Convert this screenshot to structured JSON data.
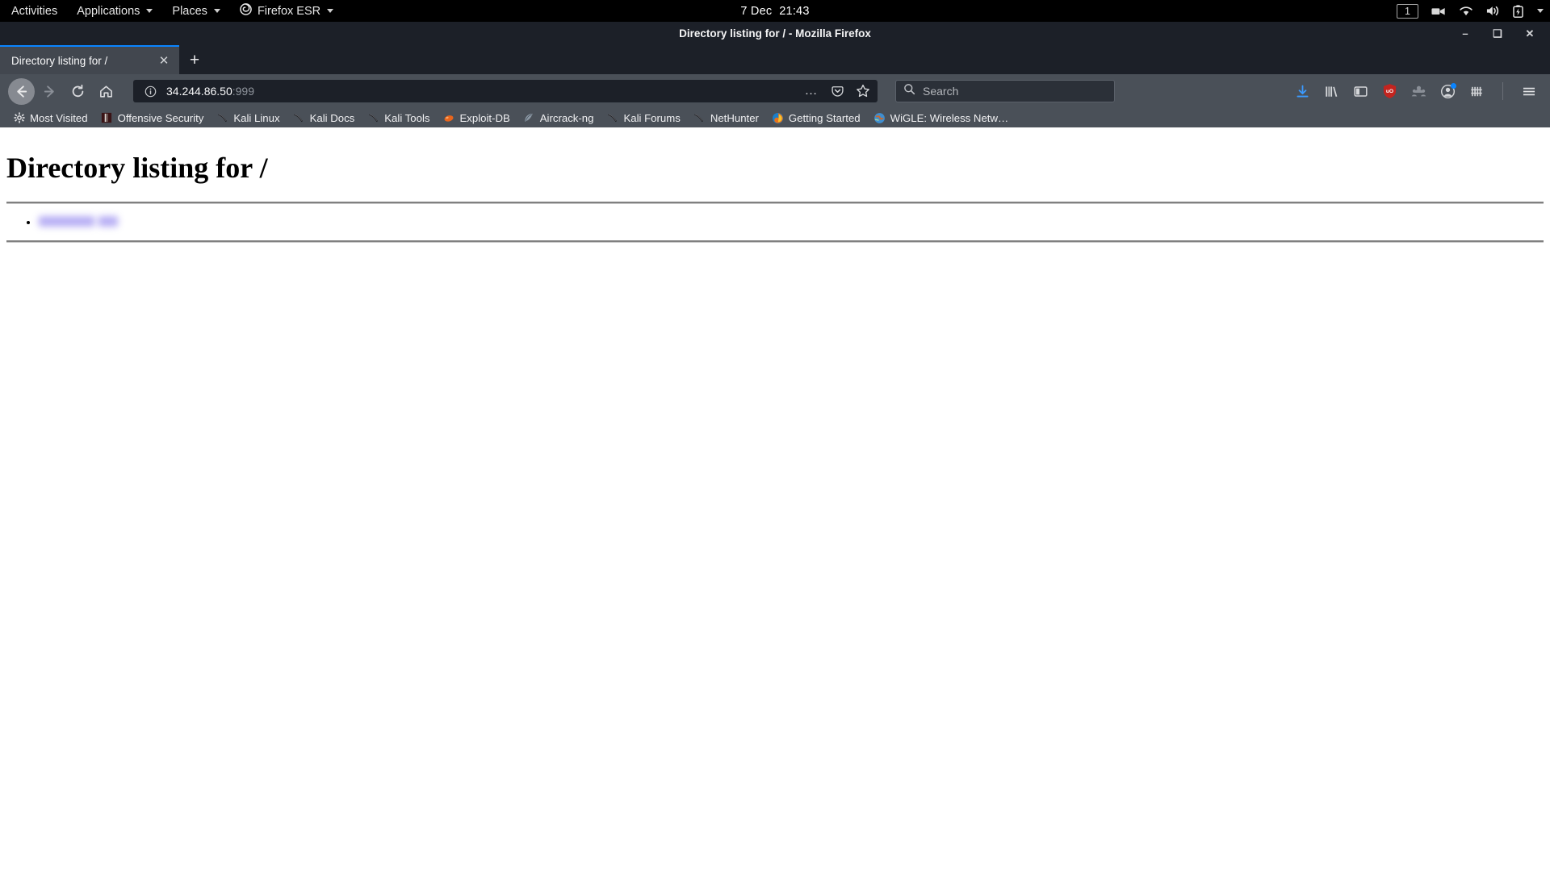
{
  "gnome": {
    "activities": "Activities",
    "applications": "Applications",
    "places": "Places",
    "app_menu": "Firefox ESR",
    "clock_date": "7 Dec",
    "clock_time": "21:43",
    "workspace": "1",
    "tray_icons": [
      "screencast-icon",
      "wifi-icon",
      "volume-icon",
      "battery-icon",
      "chevron-down-icon"
    ]
  },
  "window": {
    "title": "Directory listing for / - Mozilla Firefox",
    "minimize_label": "–",
    "maximize_label": "❑",
    "close_label": "✕"
  },
  "tabs": {
    "items": [
      {
        "label": "Directory listing for /",
        "close_label": "✕",
        "active": true
      }
    ],
    "new_tab_label": "+"
  },
  "nav": {
    "back_icon": "back-arrow-icon",
    "forward_icon": "forward-arrow-icon",
    "reload_icon": "reload-icon",
    "home_icon": "home-icon"
  },
  "urlbar": {
    "identity_icon": "info-circle-icon",
    "host": "34.244.86.50",
    "port": ":999",
    "page_actions_label": "…",
    "pocket_icon": "pocket-icon",
    "bookmark_icon": "star-icon"
  },
  "search": {
    "placeholder": "Search",
    "icon": "search-icon"
  },
  "toolbar": {
    "icons": [
      {
        "name": "downloads-icon"
      },
      {
        "name": "library-icon"
      },
      {
        "name": "sidebar-icon"
      },
      {
        "name": "ublock-origin-icon",
        "badge": "uO"
      },
      {
        "name": "people-icon"
      },
      {
        "name": "account-icon",
        "has_dot": true
      },
      {
        "name": "grid-icon"
      },
      {
        "name": "hamburger-menu-icon"
      }
    ]
  },
  "bookmarks": {
    "items": [
      {
        "label": "Most Visited",
        "icon": "gear-icon"
      },
      {
        "label": "Offensive Security",
        "icon": "offsec-icon"
      },
      {
        "label": "Kali Linux",
        "icon": "kali-dragon-icon"
      },
      {
        "label": "Kali Docs",
        "icon": "kali-dragon-icon"
      },
      {
        "label": "Kali Tools",
        "icon": "kali-dragon-icon"
      },
      {
        "label": "Exploit-DB",
        "icon": "exploitdb-icon"
      },
      {
        "label": "Aircrack-ng",
        "icon": "aircrack-icon"
      },
      {
        "label": "Kali Forums",
        "icon": "kali-dragon-icon"
      },
      {
        "label": "NetHunter",
        "icon": "kali-dragon-icon"
      },
      {
        "label": "Getting Started",
        "icon": "firefox-icon"
      },
      {
        "label": "WiGLE: Wireless Netw…",
        "icon": "globe-icon"
      }
    ]
  },
  "page": {
    "heading": "Directory listing for /",
    "entries": [
      {
        "label": "",
        "redacted": true,
        "color": "#7a69d9"
      }
    ]
  }
}
